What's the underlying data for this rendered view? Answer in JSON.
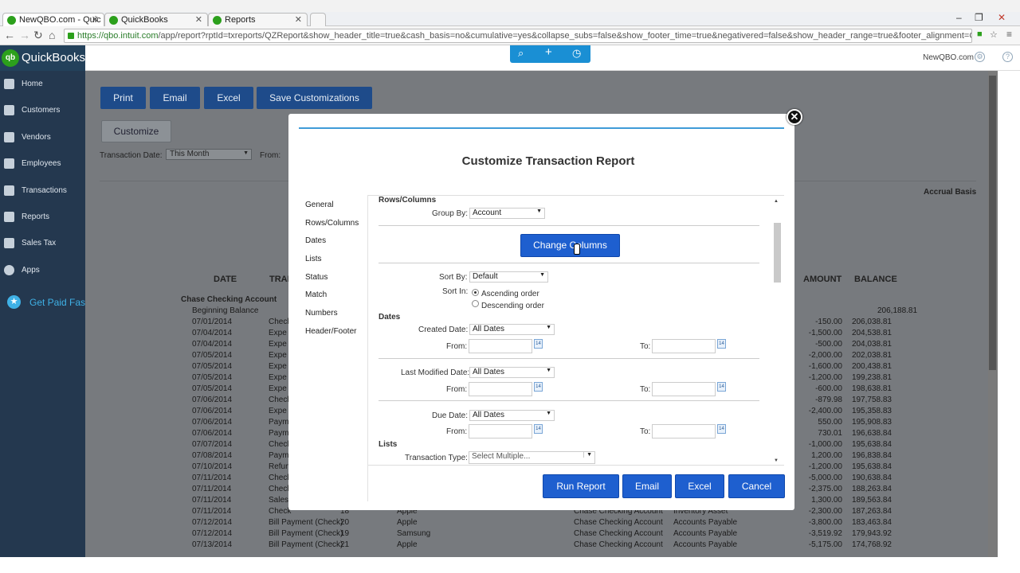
{
  "browser": {
    "tabs": [
      {
        "label": "NewQBO.com - Quic"
      },
      {
        "label": "QuickBooks"
      },
      {
        "label": "Reports"
      }
    ],
    "url_host": "https://qbo.intuit.com",
    "url_path": "/app/report?rptId=txreports/QZReport&show_header_title=true&cash_basis=no&cumulative=yes&collapse_subs=false&show_footer_time=true&negativered=false&show_header_range=true&footer_alignment=Cent"
  },
  "sidebar": {
    "brand": "QuickBooks",
    "brand_logo": "qb",
    "items": [
      {
        "label": "Home"
      },
      {
        "label": "Customers"
      },
      {
        "label": "Vendors"
      },
      {
        "label": "Employees"
      },
      {
        "label": "Transactions"
      },
      {
        "label": "Reports"
      },
      {
        "label": "Sales Tax"
      },
      {
        "label": "Apps"
      }
    ],
    "get_paid": "Get Paid Fas"
  },
  "header": {
    "company": "NewQBO.com"
  },
  "report": {
    "buttons": {
      "print": "Print",
      "email": "Email",
      "excel": "Excel",
      "save": "Save Customizations"
    },
    "customize": "Customize",
    "transaction_date_label": "Transaction Date:",
    "transaction_date_value": "This Month",
    "from_label": "From:",
    "accrual_basis": "Accrual Basis",
    "columns": {
      "date": "DATE",
      "tran": "TRAN",
      "amount": "AMOUNT",
      "balance": "BALANCE"
    },
    "account": "Chase Checking Account",
    "beginning": {
      "label": "Beginning Balance",
      "balance": "206,188.81"
    },
    "rows": [
      {
        "date": "07/01/2014",
        "type": "Check",
        "num": "",
        "name": "",
        "account": "",
        "split": "",
        "amount": "-150.00",
        "balance": "206,038.81"
      },
      {
        "date": "07/04/2014",
        "type": "Expe",
        "num": "",
        "name": "",
        "account": "",
        "split": "",
        "amount": "-1,500.00",
        "balance": "204,538.81"
      },
      {
        "date": "07/04/2014",
        "type": "Expe",
        "num": "",
        "name": "",
        "account": "",
        "split": "",
        "amount": "-500.00",
        "balance": "204,038.81"
      },
      {
        "date": "07/05/2014",
        "type": "Expe",
        "num": "",
        "name": "",
        "account": "",
        "split": "",
        "amount": "-2,000.00",
        "balance": "202,038.81"
      },
      {
        "date": "07/05/2014",
        "type": "Expe",
        "num": "",
        "name": "",
        "account": "",
        "split": "",
        "amount": "-1,600.00",
        "balance": "200,438.81"
      },
      {
        "date": "07/05/2014",
        "type": "Expe",
        "num": "",
        "name": "",
        "account": "",
        "split": "",
        "amount": "-1,200.00",
        "balance": "199,238.81"
      },
      {
        "date": "07/05/2014",
        "type": "Expe",
        "num": "",
        "name": "",
        "account": "",
        "split": "",
        "amount": "-600.00",
        "balance": "198,638.81"
      },
      {
        "date": "07/06/2014",
        "type": "Check",
        "num": "",
        "name": "",
        "account": "",
        "split": "",
        "amount": "-879.98",
        "balance": "197,758.83"
      },
      {
        "date": "07/06/2014",
        "type": "Expe",
        "num": "",
        "name": "",
        "account": "",
        "split": "",
        "amount": "-2,400.00",
        "balance": "195,358.83"
      },
      {
        "date": "07/06/2014",
        "type": "Paym",
        "num": "",
        "name": "",
        "account": "",
        "split": "",
        "amount": "550.00",
        "balance": "195,908.83"
      },
      {
        "date": "07/06/2014",
        "type": "Paym",
        "num": "",
        "name": "",
        "account": "",
        "split": "",
        "amount": "730.01",
        "balance": "196,638.84"
      },
      {
        "date": "07/07/2014",
        "type": "Check",
        "num": "",
        "name": "",
        "account": "",
        "split": "",
        "amount": "-1,000.00",
        "balance": "195,638.84"
      },
      {
        "date": "07/08/2014",
        "type": "Paym",
        "num": "",
        "name": "",
        "account": "",
        "split": "",
        "amount": "1,200.00",
        "balance": "196,838.84"
      },
      {
        "date": "07/10/2014",
        "type": "Refun",
        "num": "",
        "name": "",
        "account": "",
        "split": "",
        "amount": "-1,200.00",
        "balance": "195,638.84"
      },
      {
        "date": "07/11/2014",
        "type": "Check",
        "num": "",
        "name": "",
        "account": "",
        "split": "",
        "amount": "-5,000.00",
        "balance": "190,638.84"
      },
      {
        "date": "07/11/2014",
        "type": "Check",
        "num": "",
        "name": "",
        "account": "",
        "split": "",
        "amount": "-2,375.00",
        "balance": "188,263.84"
      },
      {
        "date": "07/11/2014",
        "type": "Sales",
        "num": "",
        "name": "",
        "account": "",
        "split": "",
        "amount": "1,300.00",
        "balance": "189,563.84"
      },
      {
        "date": "07/11/2014",
        "type": "Check",
        "num": "18",
        "name": "Apple",
        "account": "Chase Checking Account",
        "split": "Inventory Asset",
        "amount": "-2,300.00",
        "balance": "187,263.84"
      },
      {
        "date": "07/12/2014",
        "type": "Bill Payment (Check)",
        "num": "20",
        "name": "Apple",
        "account": "Chase Checking Account",
        "split": "Accounts Payable",
        "amount": "-3,800.00",
        "balance": "183,463.84"
      },
      {
        "date": "07/12/2014",
        "type": "Bill Payment (Check)",
        "num": "19",
        "name": "Samsung",
        "account": "Chase Checking Account",
        "split": "Accounts Payable",
        "amount": "-3,519.92",
        "balance": "179,943.92"
      },
      {
        "date": "07/13/2014",
        "type": "Bill Payment (Check)",
        "num": "21",
        "name": "Apple",
        "account": "Chase Checking Account",
        "split": "Accounts Payable",
        "amount": "-5,175.00",
        "balance": "174,768.92"
      }
    ]
  },
  "modal": {
    "title": "Customize Transaction Report",
    "nav": [
      "General",
      "Rows/Columns",
      "Dates",
      "Lists",
      "Status",
      "Match",
      "Numbers",
      "Header/Footer"
    ],
    "rows_columns_heading": "Rows/Columns",
    "group_by_label": "Group By:",
    "group_by_value": "Account",
    "change_columns": "Change Columns",
    "sort_by_label": "Sort By:",
    "sort_by_value": "Default",
    "sort_in_label": "Sort In:",
    "ascending": "Ascending order",
    "descending": "Descending order",
    "sort_order_selected": "Ascending order",
    "dates_heading": "Dates",
    "created_date_label": "Created Date:",
    "created_date_value": "All Dates",
    "last_modified_label": "Last Modified Date:",
    "last_modified_value": "All Dates",
    "due_date_label": "Due Date:",
    "due_date_value": "All Dates",
    "from_label": "From:",
    "to_label": "To:",
    "calendar_day": "14",
    "lists_heading": "Lists",
    "transaction_type_label": "Transaction Type:",
    "transaction_type_placeholder": "Select Multiple...",
    "buttons": {
      "run": "Run Report",
      "email": "Email",
      "excel": "Excel",
      "cancel": "Cancel"
    }
  }
}
